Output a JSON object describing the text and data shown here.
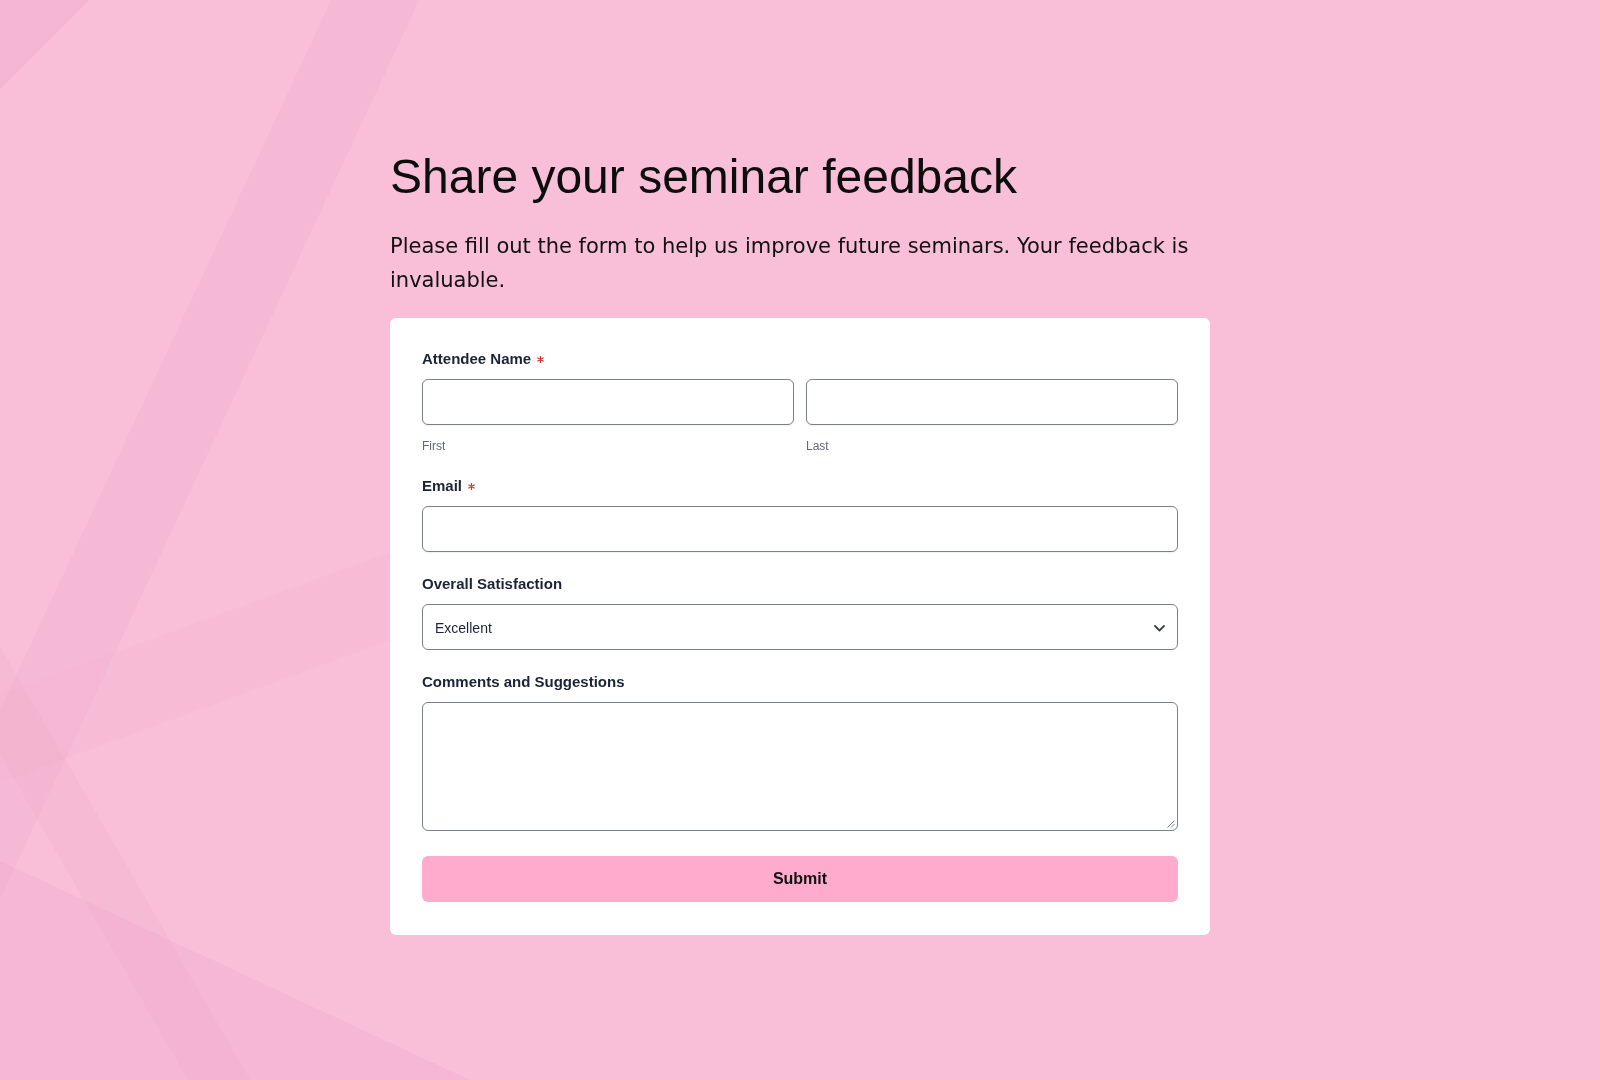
{
  "title": "Share your seminar feedback",
  "description": "Please fill out the form to help us improve future seminars. Your feedback is invaluable.",
  "form": {
    "fields": [
      {
        "kind": "name",
        "label": "Attendee Name",
        "required": true,
        "parts": [
          {
            "sublabel": "First"
          },
          {
            "sublabel": "Last"
          }
        ]
      },
      {
        "kind": "email",
        "label": "Email",
        "required": true
      },
      {
        "kind": "select",
        "label": "Overall Satisfaction",
        "required": false,
        "value": "Excellent"
      },
      {
        "kind": "textarea",
        "label": "Comments and Suggestions",
        "required": false
      }
    ],
    "submit": "Submit"
  }
}
